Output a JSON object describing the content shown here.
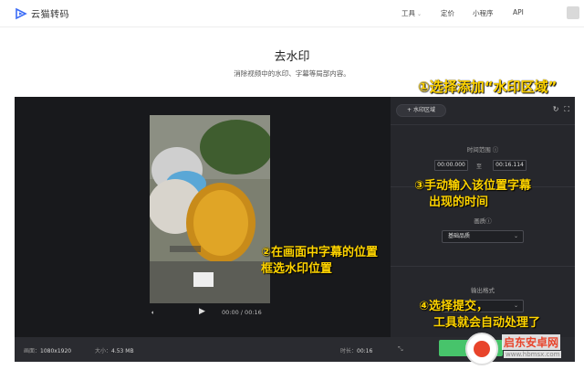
{
  "header": {
    "logo_text": "云猫转码",
    "nav": [
      {
        "label": "工具",
        "has_dropdown": true
      },
      {
        "label": "定价"
      },
      {
        "label": "小程序"
      },
      {
        "label": "API"
      }
    ]
  },
  "page": {
    "title": "去水印",
    "subtitle": "消除视频中的水印、字幕等局部内容。"
  },
  "editor": {
    "add_watermark_button": "+ 水印区域",
    "time_range_label": "时间范围 ⓘ",
    "start_time": "00:00.000",
    "to_label": "至",
    "end_time": "00:16.114",
    "quality_label": "画质ⓘ",
    "quality_value": "基础品质",
    "output_label": "输出格式",
    "playback_time": "00:00 / 00:16",
    "resolution_label": "画面：",
    "resolution_value": "1080x1920",
    "size_label": "大小：",
    "size_value": "4.53 MB",
    "duration_label": "时长：",
    "duration_value": "00:16"
  },
  "annotations": {
    "step1": "①选择添加“水印区域”",
    "step2_line1": "②在画面中字幕的位置",
    "step2_line2": "框选水印位置",
    "step3_line1": "③手动输入该位置字幕",
    "step3_line2": "出现的时间",
    "step4_line1": "④选择提交，",
    "step4_line2": "工具就会自动处理了"
  },
  "watermark": {
    "name": "启东安卓网",
    "url": "www.hbmsx.com"
  },
  "colors": {
    "annotation": "#ffd400",
    "submit": "#47c46b",
    "editor_bg": "#1d1e22"
  }
}
